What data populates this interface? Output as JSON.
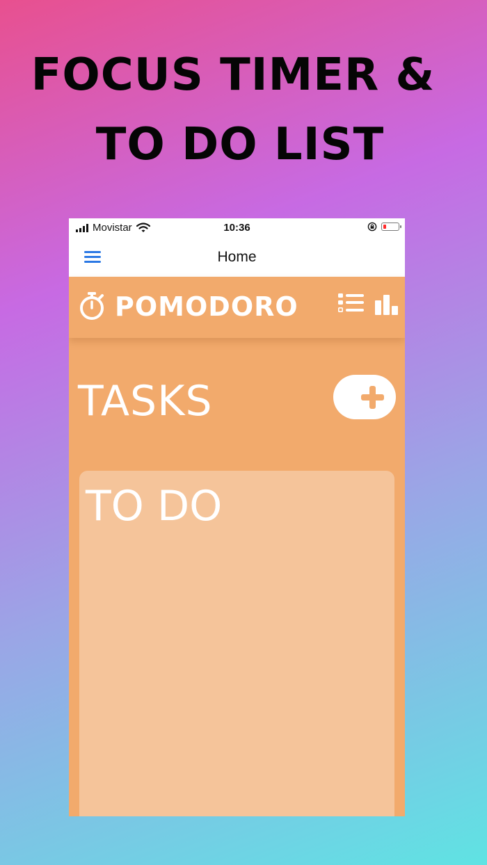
{
  "promo": {
    "headline_line1": "FOCUS TIMER &",
    "headline_line2": "TO DO LIST"
  },
  "status_bar": {
    "carrier": "Movistar",
    "time": "10:36"
  },
  "navbar": {
    "title": "Home"
  },
  "app_header": {
    "title": "POMODORO"
  },
  "tasks": {
    "title": "TASKS"
  },
  "todo_panel": {
    "title": "TO DO"
  },
  "colors": {
    "accent": "#f2aa6c",
    "panel": "#f5c49a",
    "nav_icon": "#2b78e4",
    "battery_low": "#ff2b2b"
  },
  "icons": [
    "signal-icon",
    "wifi-icon",
    "orientation-lock-icon",
    "battery-icon",
    "hamburger-menu-icon",
    "stopwatch-icon",
    "task-list-icon",
    "bar-chart-icon",
    "plus-icon"
  ]
}
